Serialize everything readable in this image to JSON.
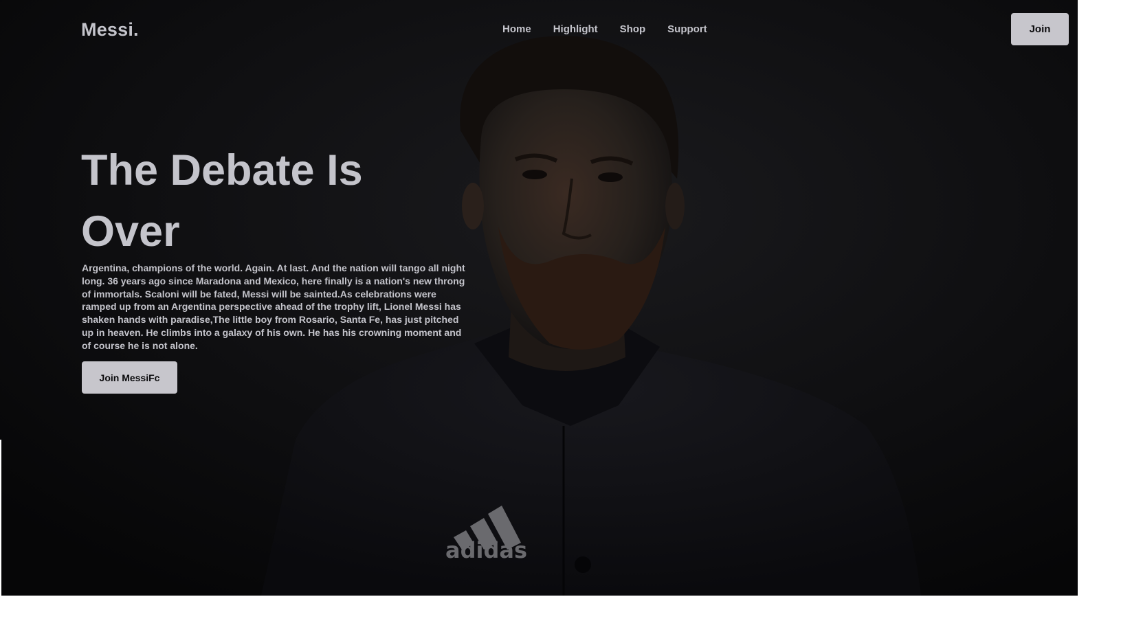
{
  "header": {
    "logo": "Messi.",
    "nav": [
      {
        "label": "Home"
      },
      {
        "label": "Highlight"
      },
      {
        "label": "Shop"
      },
      {
        "label": "Support"
      }
    ],
    "join_label": "Join"
  },
  "hero": {
    "headline": "The Debate Is Over",
    "body": "Argentina, champions of the world. Again. At last. And the nation will tango all night long. 36 years ago since Maradona and Mexico, here finally is a nation's new throng of immortals. Scaloni will be fated, Messi will be sainted.As celebrations were ramped up from an Argentina perspective ahead of the trophy lift, Lionel Messi has shaken hands with paradise,The little boy from Rosario, Santa Fe, has just pitched up in heaven. He climbs into a galaxy of his own. He has his crowning moment and of course he is not alone.",
    "cta_label": "Join MessiFc",
    "jacket_logo": "adidas"
  },
  "colors": {
    "background": "#08080a",
    "text": "#c4c4cb",
    "button_bg": "#c7c6cc",
    "button_text": "#0b0b0d"
  }
}
